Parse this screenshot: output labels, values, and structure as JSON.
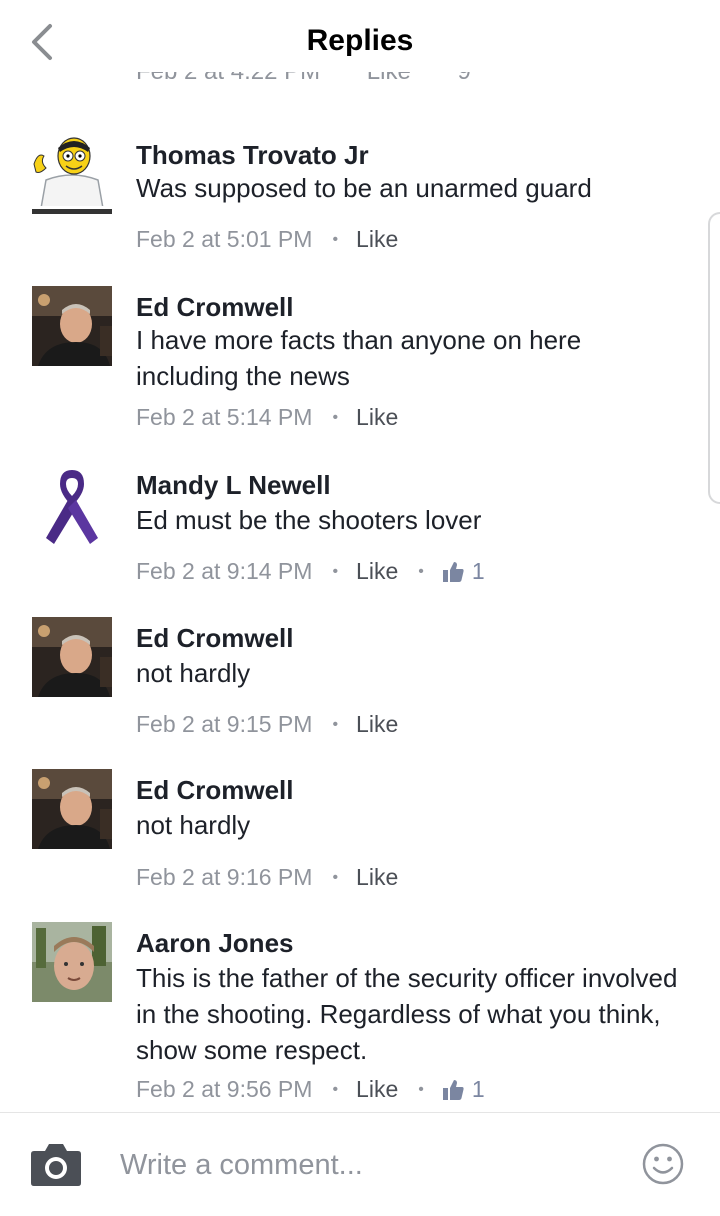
{
  "header": {
    "title": "Replies"
  },
  "previous_meta": {
    "time": "Feb 2 at 4:22 PM",
    "like": "Like",
    "reaction_count": "9"
  },
  "comments": [
    {
      "author": "Thomas Trovato Jr",
      "text": "Was supposed to be an unarmed guard",
      "time": "Feb 2 at 5:01 PM",
      "like": "Like",
      "avatar": "cartoon-avatar"
    },
    {
      "author": "Ed Cromwell",
      "text": "I have more facts than anyone on here including the news",
      "time": "Feb 2 at 5:14 PM",
      "like": "Like",
      "avatar": "photo-avatar"
    },
    {
      "author": "Mandy L Newell",
      "text": "Ed must be the shooters lover",
      "time": "Feb 2 at 9:14 PM",
      "like": "Like",
      "reaction_count": "1",
      "avatar": "purple-ribbon-avatar"
    },
    {
      "author": "Ed Cromwell",
      "text": "not hardly",
      "time": "Feb 2 at 9:15 PM",
      "like": "Like",
      "avatar": "photo-avatar"
    },
    {
      "author": "Ed Cromwell",
      "text": "not hardly",
      "time": "Feb 2 at 9:16 PM",
      "like": "Like",
      "avatar": "photo-avatar"
    },
    {
      "author": "Aaron Jones",
      "text": "This is the father of the security officer involved in the shooting. Regardless of what you think, show some respect.",
      "time": "Feb 2 at 9:56 PM",
      "like": "Like",
      "reaction_count": "1",
      "avatar": "photo-avatar"
    }
  ],
  "composer": {
    "placeholder": "Write a comment...",
    "camera_icon": "camera-icon",
    "emoji_icon": "smiley-icon"
  },
  "colors": {
    "text": "#1d2129",
    "meta": "#90949c",
    "like": "#4b4f56",
    "ribbon": "#4a2a86"
  }
}
